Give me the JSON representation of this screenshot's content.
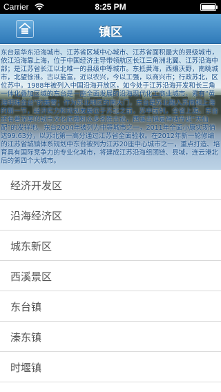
{
  "status_bar": {
    "carrier": "Carrier",
    "time": "8:25 PM"
  },
  "nav": {
    "title": "镇区",
    "home_icon": "home-icon"
  },
  "banner": {
    "text": "东台是华东沿海城市、江苏省区域中心城市、江苏省面积最大的县级城市，依江沿海靠上海，位于中国经济主导带领航区长江三角洲北翼、江苏沿海中部；是江苏省长江以北唯一的县级中等城市。东抵黄海，西攘沃野，南眺城市，北望徐淮。古以盐富，近以农兴，今以工强，以商兴市；行政苏北，区位苏中。1988年被列入中国沿海开放区，如今处于江苏沿海开发和长三角一体化叠加区域的东台是一座全面发展的沿海现代化工商业城市，素有“黄海明珠金台”的美誉；作为苏北地区的南大门，东台是苏北融入苏南和上海的第一节，经济实力和规划发展位于苏北之前，苏中前列，全省上游。东台还有着深厚的城市文化底蕴和众多名胜古迹，西溪古镇是神话传说“天仙配”的发祥地。东台2004年被列为中等城市之一，2011年全面小康实现值达99.63分，以苏北第一高分通过江苏省全面验收。在2012年新一轮修编的江苏省城镇体系规划中东台被列为江苏20座中心城市之一，重点打造、培育具有国际竞争力的专业化城市，将建成江苏沿海组团链、县域，连云港北后的第四个大城市。"
  },
  "list": {
    "items": [
      {
        "label": "经济开发区"
      },
      {
        "label": "沿海经济区"
      },
      {
        "label": "城东新区"
      },
      {
        "label": "西溪景区"
      },
      {
        "label": "东台镇"
      },
      {
        "label": "溱东镇"
      },
      {
        "label": "时堰镇"
      }
    ]
  }
}
